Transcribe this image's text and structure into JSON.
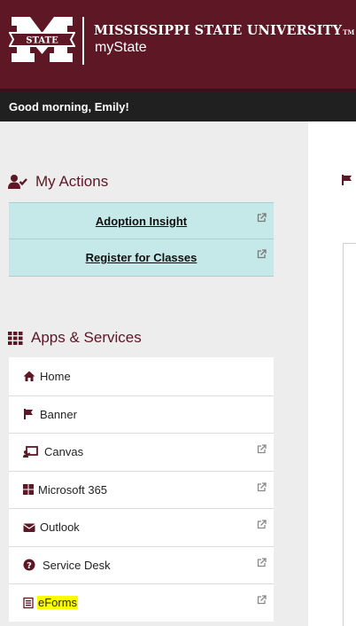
{
  "header": {
    "university_name": "MISSISSIPPI STATE UNIVERSITY",
    "tm": "TM",
    "app_name": "myState"
  },
  "greeting": "Good morning, Emily!",
  "my_actions": {
    "title": "My Actions",
    "items": [
      {
        "label": "Adoption Insight",
        "icon": "external-link-icon"
      },
      {
        "label": "Register for Classes",
        "icon": "external-link-icon"
      }
    ]
  },
  "apps_services": {
    "title": "Apps & Services",
    "items": [
      {
        "label": "Home",
        "icon": "home-icon"
      },
      {
        "label": "Banner",
        "icon": "flag-icon"
      },
      {
        "label": "Canvas",
        "icon": "chalkboard-icon"
      },
      {
        "label": "Microsoft 365",
        "icon": "windows-icon"
      },
      {
        "label": "Outlook",
        "icon": "envelope-icon"
      },
      {
        "label": "Service Desk",
        "icon": "question-circle-icon"
      },
      {
        "label": "eForms",
        "icon": "form-icon"
      }
    ]
  },
  "colors": {
    "maroon": "#5d1725",
    "action_bg": "#c5e8e8",
    "greeting_bar": "#202020",
    "highlight": "#ffff00"
  }
}
